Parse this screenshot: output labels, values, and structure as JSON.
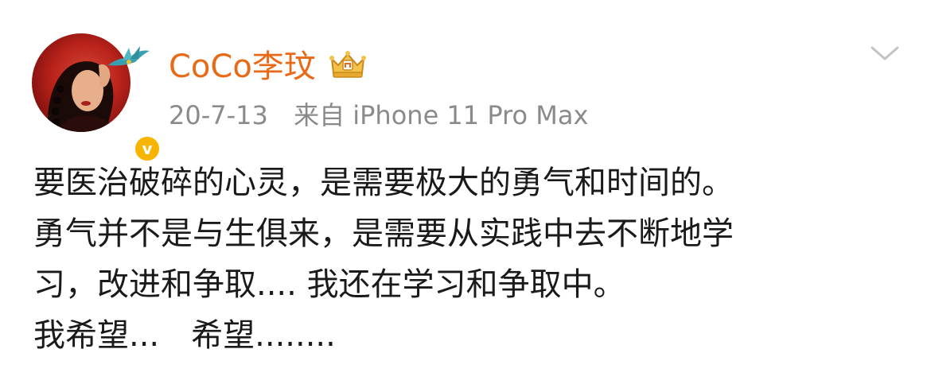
{
  "user": {
    "name": "CoCo李玟",
    "verified_symbol": "v"
  },
  "meta": {
    "date": "20-7-13",
    "source": "来自 iPhone 11 Pro Max"
  },
  "post": {
    "lines": [
      "要医治破碎的心灵，是需要极大的勇气和时间的。",
      "勇气并不是与生俱来，是需要从实践中去不断地学",
      "习，改进和争取.... 我还在学习和争取中。",
      "我希望...　希望........"
    ]
  },
  "colors": {
    "username": "#e86a17",
    "meta": "#8a8a8a",
    "text": "#1a1a1a",
    "verified_badge": "#f7b500"
  },
  "icons": {
    "avatar": "user-avatar",
    "crown": "crown-icon",
    "verified": "verified-badge-icon",
    "chevron": "chevron-down-icon"
  }
}
